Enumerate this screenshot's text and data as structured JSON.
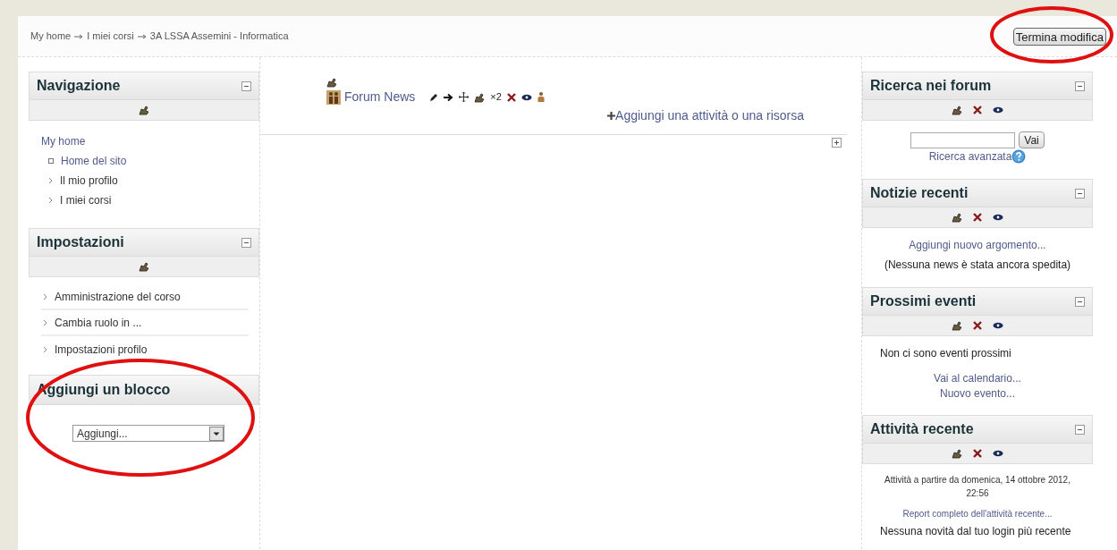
{
  "breadcrumb": [
    "My home",
    "I miei corsi",
    "3A LSSA Assemini - Informatica"
  ],
  "edit_button": "Termina modifica",
  "left_blocks": [
    {
      "kind": "navigation",
      "title": "Navigazione",
      "root": "My home",
      "items": [
        {
          "label": "Home del sito",
          "kind": "leaf"
        },
        {
          "label": "Il mio profilo",
          "kind": "branch"
        },
        {
          "label": "I miei corsi",
          "kind": "branch"
        }
      ]
    },
    {
      "kind": "settings",
      "title": "Impostazioni",
      "items": [
        {
          "label": "Amministrazione del corso",
          "kind": "branch"
        },
        {
          "label": "Cambia ruolo in ...",
          "kind": "branch"
        },
        {
          "label": "Impostazioni profilo",
          "kind": "branch"
        }
      ]
    },
    {
      "kind": "add_block",
      "title": "Aggiungi un blocco",
      "select": "Aggiungi..."
    }
  ],
  "section": {
    "activity": "Forum News",
    "group_count": "×2",
    "add_link": "Aggiungi una attività o una risorsa"
  },
  "right_blocks": [
    {
      "title": "Ricerca nei forum",
      "lines": [
        {
          "kind": "search",
          "button": "Vai"
        },
        {
          "kind": "help_link",
          "text": "Ricerca avanzata"
        }
      ]
    },
    {
      "title": "Notizie recenti",
      "lines": [
        {
          "kind": "link",
          "text": "Aggiungi nuovo argomento..."
        },
        {
          "kind": "text",
          "text": "(Nessuna news è stata ancora spedita)"
        }
      ]
    },
    {
      "title": "Prossimi eventi",
      "lines": [
        {
          "kind": "text_left",
          "text": "Non ci sono eventi prossimi"
        },
        {
          "kind": "link",
          "text": "Vai al calendario..."
        },
        {
          "kind": "link",
          "text": "Nuovo evento..."
        }
      ]
    },
    {
      "title": "Attività recente",
      "lines": [
        {
          "kind": "small",
          "text": "Attività a partire da domenica, 14 ottobre 2012, 22:56"
        },
        {
          "kind": "small_link",
          "text": "Report completo dell'attività recente..."
        },
        {
          "kind": "text_left",
          "text": "Nessuna novità dal tuo login più recente"
        }
      ]
    }
  ]
}
